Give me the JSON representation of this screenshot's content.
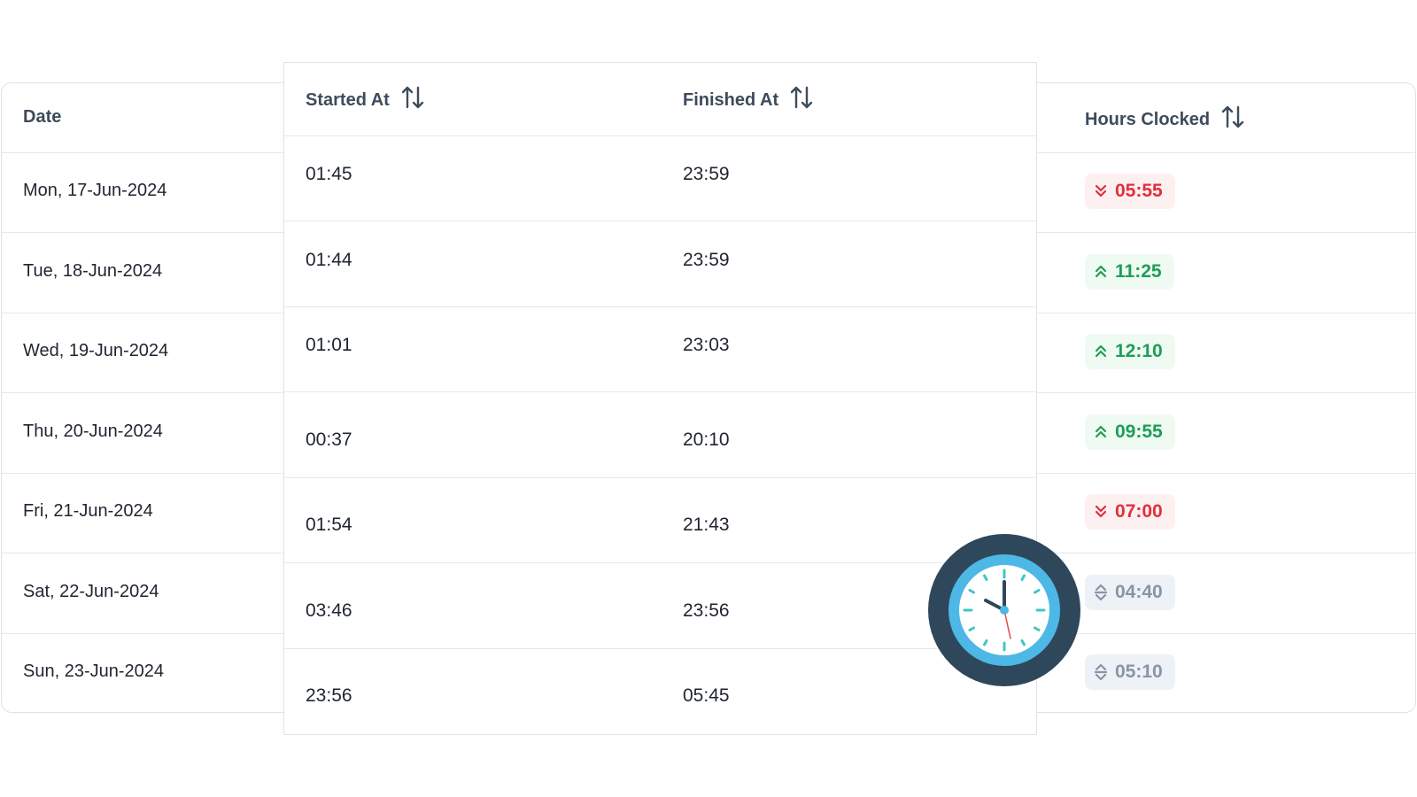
{
  "columns": {
    "date": "Date",
    "started_at": "Started At",
    "finished_at": "Finished At",
    "hours_clocked": "Hours Clocked"
  },
  "sort_icon": "sort-up-down-icon",
  "rows": [
    {
      "date": "Mon, 17-Jun-2024",
      "started": "01:45",
      "finished": "23:59",
      "hours": "05:55",
      "trend": "down"
    },
    {
      "date": "Tue, 18-Jun-2024",
      "started": "01:44",
      "finished": "23:59",
      "hours": "11:25",
      "trend": "up"
    },
    {
      "date": "Wed, 19-Jun-2024",
      "started": "01:01",
      "finished": "23:03",
      "hours": "12:10",
      "trend": "up"
    },
    {
      "date": "Thu, 20-Jun-2024",
      "started": "00:37",
      "finished": "20:10",
      "hours": "09:55",
      "trend": "up"
    },
    {
      "date": "Fri, 21-Jun-2024",
      "started": "01:54",
      "finished": "21:43",
      "hours": "07:00",
      "trend": "down"
    },
    {
      "date": "Sat, 22-Jun-2024",
      "started": "03:46",
      "finished": "23:56",
      "hours": "04:40",
      "trend": "flat"
    },
    {
      "date": "Sun, 23-Jun-2024",
      "started": "23:56",
      "finished": "05:45",
      "hours": "05:10",
      "trend": "flat"
    }
  ],
  "colors": {
    "down": "#e02f3d",
    "up": "#1f9d55",
    "flat": "#8795a6",
    "clock_rim": "#2f475b",
    "clock_ring": "#4db8e6",
    "clock_ticks": "#3cc8c4"
  },
  "icons": {
    "down": "chevrons-down-icon",
    "up": "chevrons-up-icon",
    "flat": "chevrons-up-down-icon",
    "clock": "clock-icon"
  }
}
